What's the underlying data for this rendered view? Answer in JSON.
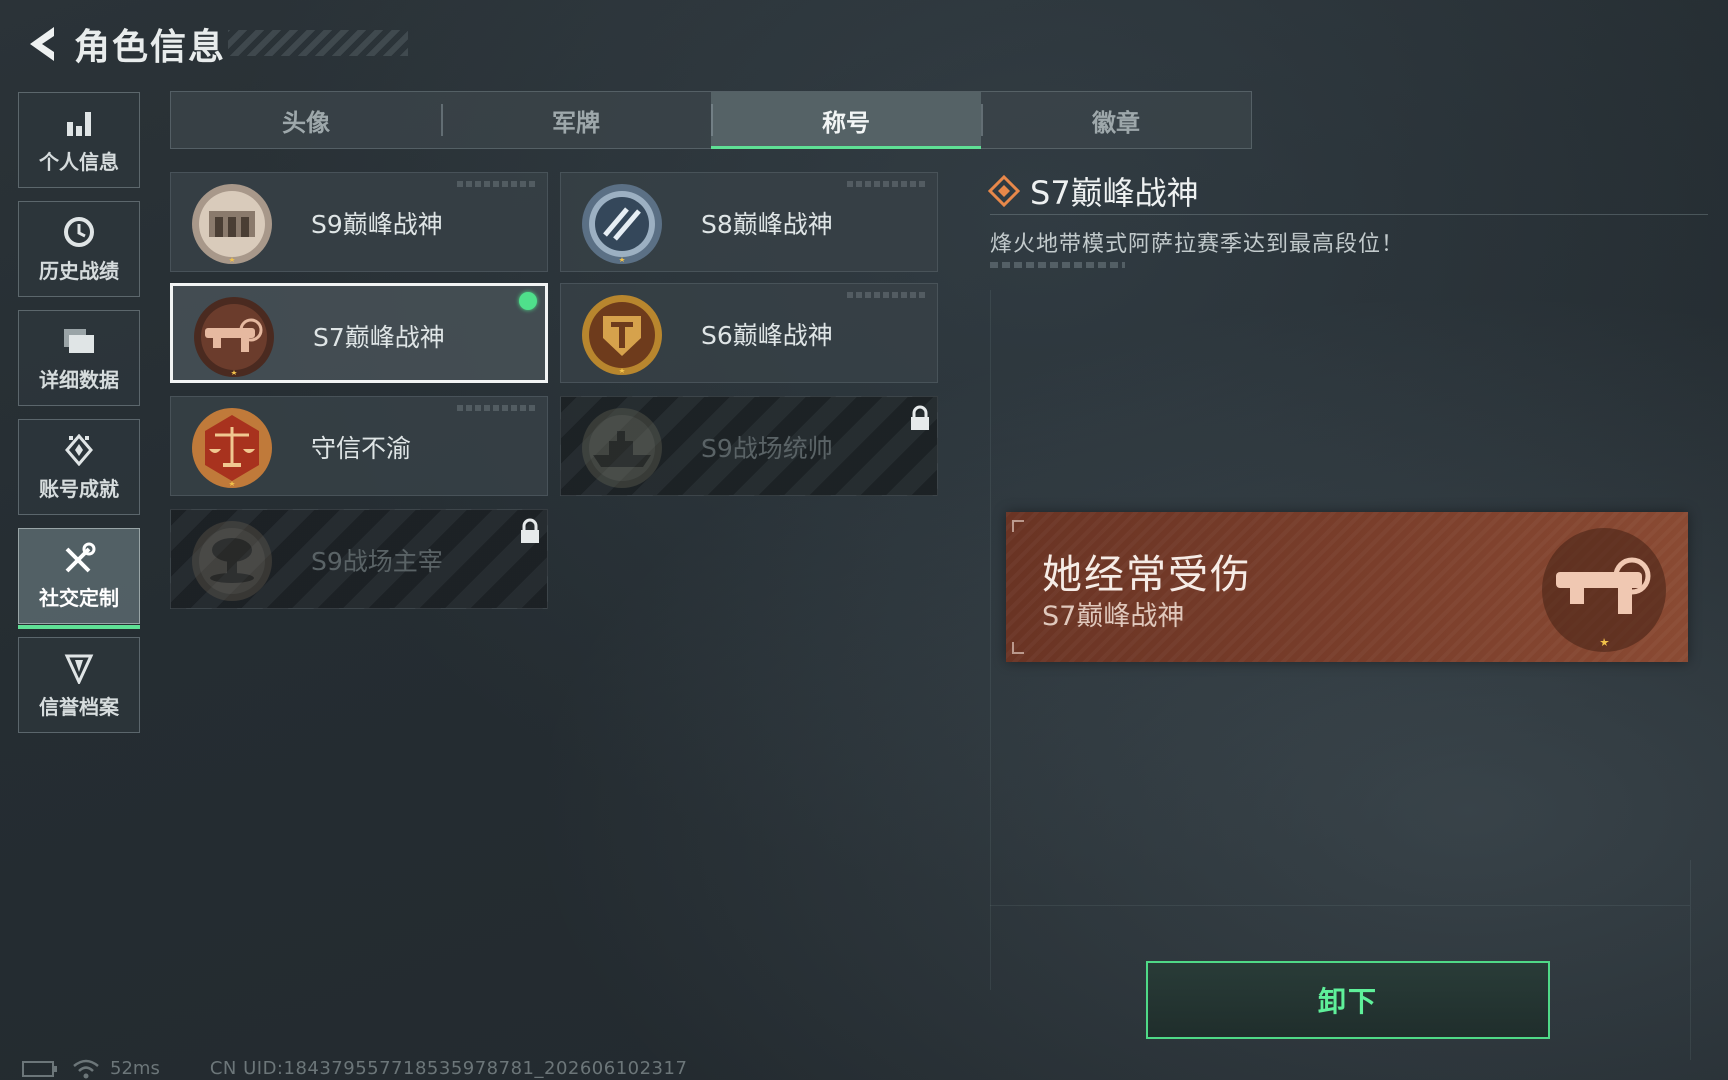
{
  "header": {
    "title": "角色信息"
  },
  "sidebar": {
    "items": [
      {
        "label": "个人信息",
        "icon": "bar-chart-icon"
      },
      {
        "label": "历史战绩",
        "icon": "clock-icon"
      },
      {
        "label": "详细数据",
        "icon": "folder-icon"
      },
      {
        "label": "账号成就",
        "icon": "achievement-icon"
      },
      {
        "label": "社交定制",
        "icon": "tools-icon",
        "active": true
      },
      {
        "label": "信誉档案",
        "icon": "credit-icon"
      }
    ]
  },
  "tabs": [
    {
      "label": "头像"
    },
    {
      "label": "军牌"
    },
    {
      "label": "称号",
      "active": true
    },
    {
      "label": "徽章"
    }
  ],
  "titles": [
    {
      "name": "S9巅峰战神",
      "medal": "fortress-medal-icon"
    },
    {
      "name": "S8巅峰战神",
      "medal": "blue-stripe-medal-icon"
    },
    {
      "name": "S7巅峰战神",
      "medal": "gun-medal-icon",
      "selected": true,
      "equipped": true
    },
    {
      "name": "S6巅峰战神",
      "medal": "golden-shield-medal-icon"
    },
    {
      "name": "守信不渝",
      "medal": "scales-medal-icon"
    },
    {
      "name": "S9战场统帅",
      "medal": "warship-medal-icon",
      "locked": true
    },
    {
      "name": "S9战场主宰",
      "medal": "mushroom-cloud-medal-icon",
      "locked": true
    }
  ],
  "detail": {
    "title": "S7巅峰战神",
    "description": "烽火地带模式阿萨拉赛季达到最高段位！"
  },
  "banner": {
    "player_name": "她经常受伤",
    "title": "S7巅峰战神"
  },
  "actions": {
    "unequip_label": "卸下"
  },
  "footer": {
    "ping": "52ms",
    "uid": "CN UID:1843795577185359787​81_202606102317"
  },
  "colors": {
    "accent_green": "#5fe095",
    "banner_red": "#7a3e2b",
    "equipped_dot": "#4fe08b"
  }
}
